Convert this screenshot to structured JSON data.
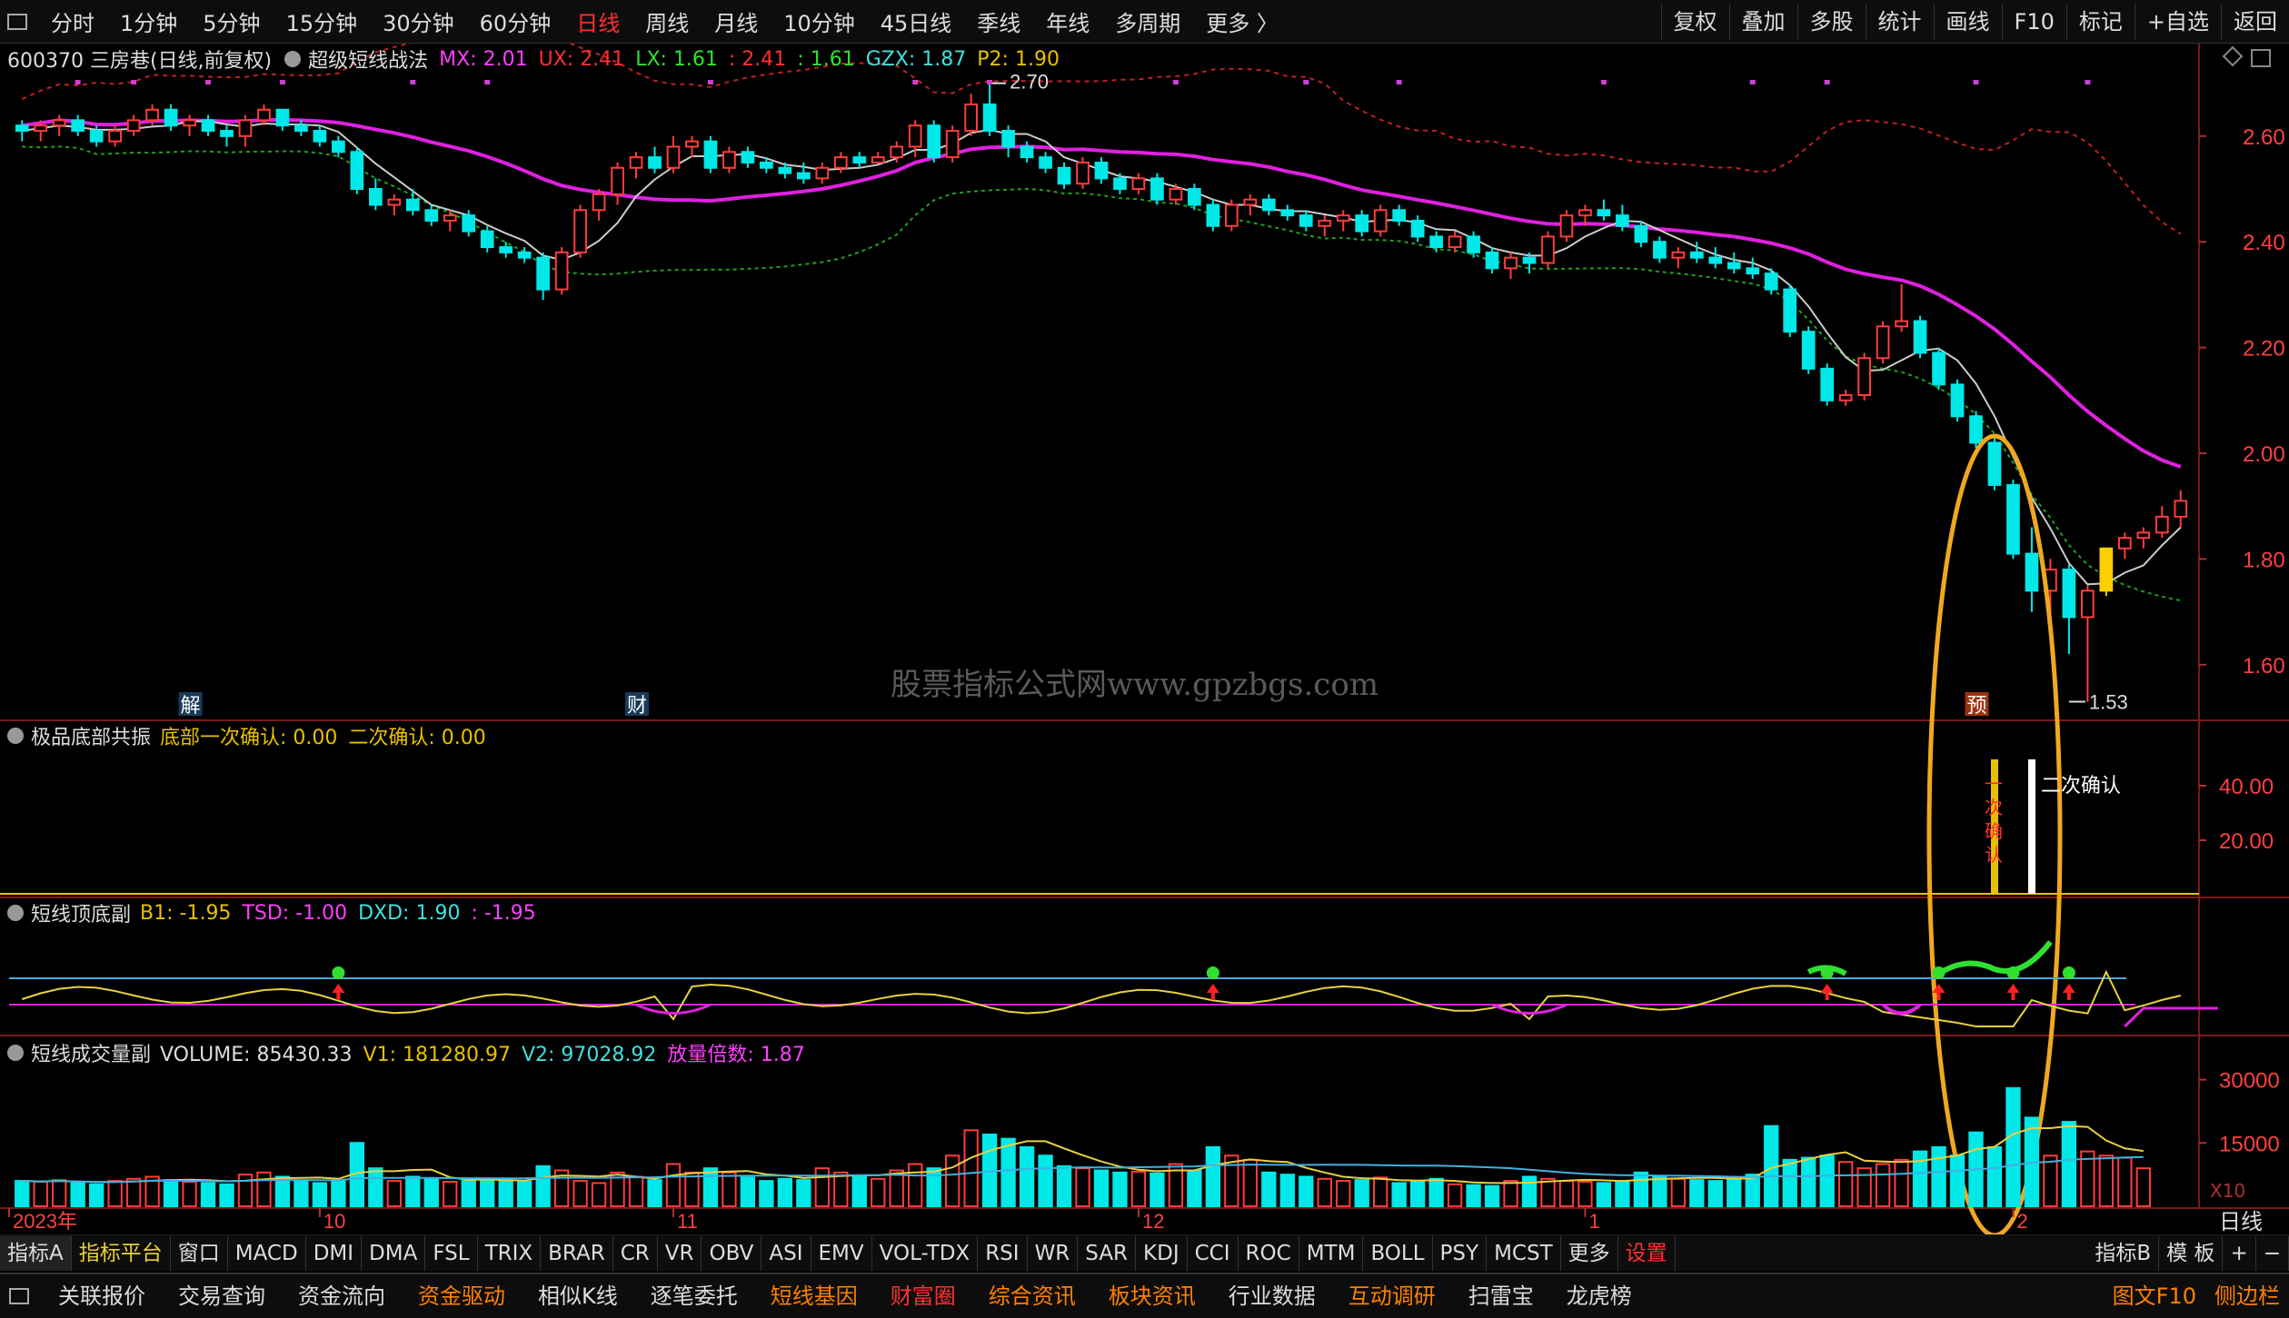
{
  "topbar": {
    "periods": [
      "分时",
      "1分钟",
      "5分钟",
      "15分钟",
      "30分钟",
      "60分钟",
      "日线",
      "周线",
      "月线",
      "10分钟",
      "45日线",
      "季线",
      "年线",
      "多周期",
      "更多 〉"
    ],
    "active_period": "日线",
    "right_buttons": [
      "复权",
      "叠加",
      "多股",
      "统计",
      "画线",
      "F10",
      "标记",
      "+自选",
      "返回"
    ]
  },
  "main_panel": {
    "stock": "600370 三房巷(日线,前复权)",
    "indicator": "超级短线战法",
    "values": [
      {
        "label": "MX: 2.01",
        "color": "#ff40ff"
      },
      {
        "label": "UX: 2.41",
        "color": "#ff3030"
      },
      {
        "label": "LX: 1.61",
        "color": "#30e030"
      },
      {
        "label": ": 2.41",
        "color": "#ff3030"
      },
      {
        "label": ": 1.61",
        "color": "#30e030"
      },
      {
        "label": "GZX: 1.87",
        "color": "#40e0e0"
      },
      {
        "label": "P2: 1.90",
        "color": "#e8c000"
      }
    ],
    "price_axis": [
      "2.60",
      "2.40",
      "2.20",
      "2.00",
      "1.80",
      "1.60"
    ],
    "high_label": "2.70",
    "low_label": "1.53",
    "event_markers": [
      "解",
      "财",
      "预"
    ],
    "watermark": "股票指标公式网www.gpzbgs.com"
  },
  "panel2": {
    "name": "极品底部共振",
    "values": [
      {
        "label": "底部一次确认: 0.00",
        "color": "#e8c000"
      },
      {
        "label": "二次确认: 0.00",
        "color": "#e8c000"
      }
    ],
    "axis": [
      "40.00",
      "20.00"
    ],
    "annotation_second": "二次确认",
    "annotation_first": "一次确认"
  },
  "panel3": {
    "name": "短线顶底副",
    "values": [
      {
        "label": "B1: -1.95",
        "color": "#e8c000"
      },
      {
        "label": "TSD: -1.00",
        "color": "#ff40ff"
      },
      {
        "label": "DXD: 1.90",
        "color": "#40e0e0"
      },
      {
        "label": ": -1.95",
        "color": "#ff40ff"
      }
    ]
  },
  "panel4": {
    "name": "短线成交量副",
    "values": [
      {
        "label": "VOLUME: 85430.33",
        "color": "#dddddd"
      },
      {
        "label": "V1: 181280.97",
        "color": "#e8c000"
      },
      {
        "label": "V2: 97028.92",
        "color": "#40e0e0"
      },
      {
        "label": "放量倍数: 1.87",
        "color": "#ff40ff"
      }
    ],
    "axis": [
      "30000",
      "15000"
    ],
    "unit": "X10"
  },
  "time_axis": {
    "labels": [
      "2023年",
      "10",
      "11",
      "12",
      "1",
      "2"
    ],
    "period_label": "日线"
  },
  "bottom_tabs": {
    "items": [
      "指标A",
      "指标平台",
      "窗口",
      "MACD",
      "DMI",
      "DMA",
      "FSL",
      "TRIX",
      "BRAR",
      "CR",
      "VR",
      "OBV",
      "ASI",
      "EMV",
      "VOL-TDX",
      "RSI",
      "WR",
      "SAR",
      "KDJ",
      "CCI",
      "ROC",
      "MTM",
      "BOLL",
      "PSY",
      "MCST",
      "更多",
      "设置"
    ],
    "right": [
      "指标B",
      "模 板",
      "+",
      "−"
    ]
  },
  "info_bar": {
    "items": [
      {
        "label": "关联报价",
        "color": "#dddddd"
      },
      {
        "label": "交易查询",
        "color": "#dddddd"
      },
      {
        "label": "资金流向",
        "color": "#dddddd"
      },
      {
        "label": "资金驱动",
        "color": "#ff8000"
      },
      {
        "label": "相似K线",
        "color": "#dddddd"
      },
      {
        "label": "逐笔委托",
        "color": "#dddddd"
      },
      {
        "label": "短线基因",
        "color": "#ff8000"
      },
      {
        "label": "财富圈",
        "color": "#ff3030"
      },
      {
        "label": "综合资讯",
        "color": "#ff8000"
      },
      {
        "label": "板块资讯",
        "color": "#ff8000"
      },
      {
        "label": "行业数据",
        "color": "#dddddd"
      },
      {
        "label": "互动调研",
        "color": "#ff8000"
      },
      {
        "label": "扫雷宝",
        "color": "#dddddd"
      },
      {
        "label": "龙虎榜",
        "color": "#dddddd"
      }
    ],
    "right": [
      "图文F10",
      "侧边栏"
    ]
  },
  "series": {
    "candles": [
      [
        2.62,
        2.63,
        2.59,
        2.61
      ],
      [
        2.61,
        2.63,
        2.59,
        2.62
      ],
      [
        2.62,
        2.64,
        2.6,
        2.63
      ],
      [
        2.63,
        2.64,
        2.6,
        2.61
      ],
      [
        2.61,
        2.62,
        2.58,
        2.59
      ],
      [
        2.59,
        2.62,
        2.58,
        2.61
      ],
      [
        2.61,
        2.64,
        2.6,
        2.63
      ],
      [
        2.63,
        2.66,
        2.62,
        2.65
      ],
      [
        2.65,
        2.66,
        2.61,
        2.62
      ],
      [
        2.62,
        2.64,
        2.6,
        2.63
      ],
      [
        2.63,
        2.64,
        2.6,
        2.61
      ],
      [
        2.61,
        2.62,
        2.58,
        2.6
      ],
      [
        2.6,
        2.64,
        2.58,
        2.63
      ],
      [
        2.63,
        2.66,
        2.62,
        2.65
      ],
      [
        2.65,
        2.65,
        2.61,
        2.62
      ],
      [
        2.62,
        2.63,
        2.6,
        2.61
      ],
      [
        2.61,
        2.62,
        2.58,
        2.59
      ],
      [
        2.59,
        2.6,
        2.56,
        2.57
      ],
      [
        2.57,
        2.58,
        2.49,
        2.5
      ],
      [
        2.5,
        2.52,
        2.46,
        2.47
      ],
      [
        2.47,
        2.49,
        2.45,
        2.48
      ],
      [
        2.48,
        2.5,
        2.45,
        2.46
      ],
      [
        2.46,
        2.47,
        2.43,
        2.44
      ],
      [
        2.44,
        2.46,
        2.42,
        2.45
      ],
      [
        2.45,
        2.46,
        2.41,
        2.42
      ],
      [
        2.42,
        2.43,
        2.38,
        2.39
      ],
      [
        2.39,
        2.4,
        2.37,
        2.38
      ],
      [
        2.38,
        2.39,
        2.36,
        2.37
      ],
      [
        2.37,
        2.38,
        2.29,
        2.31
      ],
      [
        2.31,
        2.39,
        2.3,
        2.38
      ],
      [
        2.38,
        2.47,
        2.37,
        2.46
      ],
      [
        2.46,
        2.5,
        2.44,
        2.49
      ],
      [
        2.49,
        2.55,
        2.47,
        2.54
      ],
      [
        2.54,
        2.57,
        2.52,
        2.56
      ],
      [
        2.56,
        2.58,
        2.53,
        2.54
      ],
      [
        2.54,
        2.6,
        2.53,
        2.58
      ],
      [
        2.58,
        2.6,
        2.56,
        2.59
      ],
      [
        2.59,
        2.6,
        2.53,
        2.54
      ],
      [
        2.54,
        2.58,
        2.53,
        2.57
      ],
      [
        2.57,
        2.58,
        2.54,
        2.55
      ],
      [
        2.55,
        2.56,
        2.53,
        2.54
      ],
      [
        2.54,
        2.55,
        2.52,
        2.53
      ],
      [
        2.53,
        2.55,
        2.51,
        2.52
      ],
      [
        2.52,
        2.55,
        2.51,
        2.54
      ],
      [
        2.54,
        2.57,
        2.53,
        2.56
      ],
      [
        2.56,
        2.57,
        2.54,
        2.55
      ],
      [
        2.55,
        2.57,
        2.55,
        2.56
      ],
      [
        2.56,
        2.59,
        2.55,
        2.58
      ],
      [
        2.58,
        2.63,
        2.56,
        2.62
      ],
      [
        2.62,
        2.63,
        2.55,
        2.56
      ],
      [
        2.56,
        2.62,
        2.55,
        2.61
      ],
      [
        2.61,
        2.68,
        2.6,
        2.66
      ],
      [
        2.66,
        2.7,
        2.6,
        2.61
      ],
      [
        2.61,
        2.62,
        2.56,
        2.58
      ],
      [
        2.58,
        2.59,
        2.55,
        2.56
      ],
      [
        2.56,
        2.57,
        2.53,
        2.54
      ],
      [
        2.54,
        2.55,
        2.5,
        2.51
      ],
      [
        2.51,
        2.56,
        2.5,
        2.55
      ],
      [
        2.55,
        2.56,
        2.51,
        2.52
      ],
      [
        2.52,
        2.53,
        2.49,
        2.5
      ],
      [
        2.5,
        2.53,
        2.49,
        2.52
      ],
      [
        2.52,
        2.53,
        2.47,
        2.48
      ],
      [
        2.48,
        2.51,
        2.47,
        2.5
      ],
      [
        2.5,
        2.51,
        2.46,
        2.47
      ],
      [
        2.47,
        2.48,
        2.42,
        2.43
      ],
      [
        2.43,
        2.48,
        2.42,
        2.47
      ],
      [
        2.47,
        2.49,
        2.45,
        2.48
      ],
      [
        2.48,
        2.49,
        2.45,
        2.46
      ],
      [
        2.46,
        2.47,
        2.44,
        2.45
      ],
      [
        2.45,
        2.46,
        2.42,
        2.43
      ],
      [
        2.43,
        2.45,
        2.41,
        2.44
      ],
      [
        2.44,
        2.46,
        2.42,
        2.45
      ],
      [
        2.45,
        2.46,
        2.41,
        2.42
      ],
      [
        2.42,
        2.47,
        2.41,
        2.46
      ],
      [
        2.46,
        2.47,
        2.43,
        2.44
      ],
      [
        2.44,
        2.45,
        2.4,
        2.41
      ],
      [
        2.41,
        2.42,
        2.38,
        2.39
      ],
      [
        2.39,
        2.42,
        2.38,
        2.41
      ],
      [
        2.41,
        2.42,
        2.37,
        2.38
      ],
      [
        2.38,
        2.39,
        2.34,
        2.35
      ],
      [
        2.35,
        2.38,
        2.33,
        2.37
      ],
      [
        2.37,
        2.38,
        2.34,
        2.36
      ],
      [
        2.36,
        2.42,
        2.35,
        2.41
      ],
      [
        2.41,
        2.46,
        2.4,
        2.45
      ],
      [
        2.45,
        2.47,
        2.43,
        2.46
      ],
      [
        2.46,
        2.48,
        2.44,
        2.45
      ],
      [
        2.45,
        2.47,
        2.42,
        2.43
      ],
      [
        2.43,
        2.44,
        2.39,
        2.4
      ],
      [
        2.4,
        2.41,
        2.36,
        2.37
      ],
      [
        2.37,
        2.39,
        2.35,
        2.38
      ],
      [
        2.38,
        2.4,
        2.36,
        2.37
      ],
      [
        2.37,
        2.39,
        2.35,
        2.36
      ],
      [
        2.36,
        2.38,
        2.34,
        2.35
      ],
      [
        2.35,
        2.37,
        2.33,
        2.34
      ],
      [
        2.34,
        2.35,
        2.3,
        2.31
      ],
      [
        2.31,
        2.32,
        2.22,
        2.23
      ],
      [
        2.23,
        2.24,
        2.15,
        2.16
      ],
      [
        2.16,
        2.17,
        2.09,
        2.1
      ],
      [
        2.1,
        2.12,
        2.09,
        2.11
      ],
      [
        2.11,
        2.19,
        2.1,
        2.18
      ],
      [
        2.18,
        2.25,
        2.17,
        2.24
      ],
      [
        2.24,
        2.32,
        2.23,
        2.25
      ],
      [
        2.25,
        2.26,
        2.18,
        2.19
      ],
      [
        2.19,
        2.2,
        2.12,
        2.13
      ],
      [
        2.13,
        2.14,
        2.06,
        2.07
      ],
      [
        2.07,
        2.08,
        2.01,
        2.02
      ],
      [
        2.02,
        2.03,
        1.93,
        1.94
      ],
      [
        1.94,
        1.95,
        1.8,
        1.81
      ],
      [
        1.81,
        1.86,
        1.7,
        1.74
      ],
      [
        1.74,
        1.8,
        1.66,
        1.78
      ],
      [
        1.78,
        1.79,
        1.62,
        1.69
      ],
      [
        1.69,
        1.75,
        1.53,
        1.74
      ],
      [
        1.74,
        1.82,
        1.73,
        1.82
      ],
      [
        1.82,
        1.85,
        1.8,
        1.84
      ],
      [
        1.84,
        1.86,
        1.82,
        1.85
      ],
      [
        1.85,
        1.9,
        1.84,
        1.88
      ],
      [
        1.88,
        1.93,
        1.86,
        1.91
      ]
    ],
    "special_candle_index": 112,
    "volumes": [
      6000,
      5800,
      6200,
      5500,
      5200,
      6000,
      6500,
      7000,
      6200,
      5800,
      5500,
      5200,
      7500,
      8000,
      7000,
      6000,
      5500,
      6000,
      15000,
      9000,
      6000,
      7000,
      6500,
      5800,
      6000,
      6500,
      6200,
      5800,
      9500,
      8500,
      6000,
      5500,
      8000,
      7000,
      6200,
      10000,
      8000,
      9000,
      8000,
      6800,
      6000,
      6500,
      6200,
      9000,
      8000,
      7000,
      6500,
      8500,
      10000,
      9000,
      12000,
      18000,
      17000,
      16000,
      14000,
      12000,
      9500,
      9000,
      8500,
      8000,
      8200,
      7800,
      10000,
      8500,
      14000,
      12000,
      11000,
      8000,
      7500,
      7000,
      6500,
      6000,
      6200,
      6800,
      5500,
      6000,
      6500,
      5200,
      5000,
      4800,
      6000,
      7000,
      6500,
      6000,
      5800,
      5500,
      6000,
      8000,
      7000,
      6500,
      6200,
      6000,
      6800,
      7500,
      19000,
      11000,
      11500,
      12000,
      10500,
      9000,
      10000,
      11000,
      13000,
      14000,
      12000,
      17500,
      14000,
      28000,
      21000,
      12000,
      20000,
      13000,
      12000,
      11500,
      9000
    ]
  }
}
